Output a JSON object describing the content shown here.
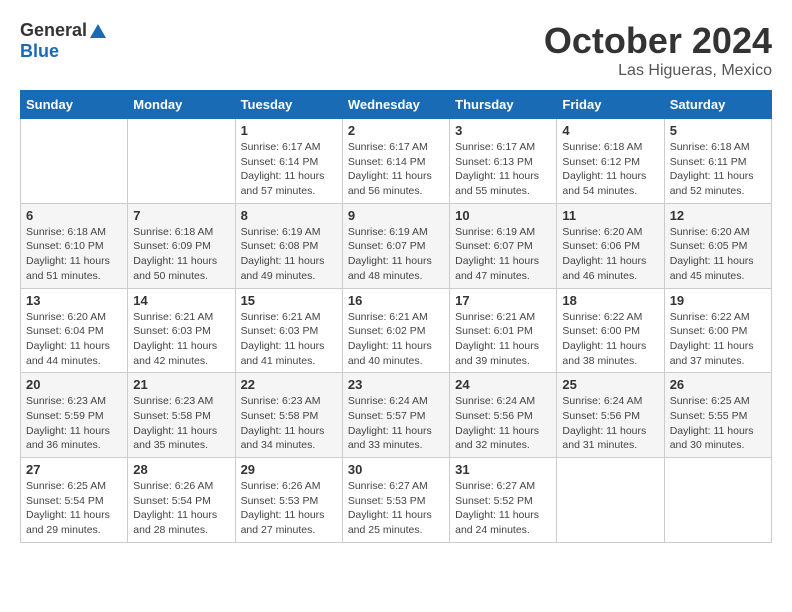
{
  "logo": {
    "general": "General",
    "blue": "Blue"
  },
  "title": {
    "month": "October 2024",
    "location": "Las Higueras, Mexico"
  },
  "calendar": {
    "headers": [
      "Sunday",
      "Monday",
      "Tuesday",
      "Wednesday",
      "Thursday",
      "Friday",
      "Saturday"
    ],
    "weeks": [
      [
        {
          "day": "",
          "info": ""
        },
        {
          "day": "",
          "info": ""
        },
        {
          "day": "1",
          "info": "Sunrise: 6:17 AM\nSunset: 6:14 PM\nDaylight: 11 hours and 57 minutes."
        },
        {
          "day": "2",
          "info": "Sunrise: 6:17 AM\nSunset: 6:14 PM\nDaylight: 11 hours and 56 minutes."
        },
        {
          "day": "3",
          "info": "Sunrise: 6:17 AM\nSunset: 6:13 PM\nDaylight: 11 hours and 55 minutes."
        },
        {
          "day": "4",
          "info": "Sunrise: 6:18 AM\nSunset: 6:12 PM\nDaylight: 11 hours and 54 minutes."
        },
        {
          "day": "5",
          "info": "Sunrise: 6:18 AM\nSunset: 6:11 PM\nDaylight: 11 hours and 52 minutes."
        }
      ],
      [
        {
          "day": "6",
          "info": "Sunrise: 6:18 AM\nSunset: 6:10 PM\nDaylight: 11 hours and 51 minutes."
        },
        {
          "day": "7",
          "info": "Sunrise: 6:18 AM\nSunset: 6:09 PM\nDaylight: 11 hours and 50 minutes."
        },
        {
          "day": "8",
          "info": "Sunrise: 6:19 AM\nSunset: 6:08 PM\nDaylight: 11 hours and 49 minutes."
        },
        {
          "day": "9",
          "info": "Sunrise: 6:19 AM\nSunset: 6:07 PM\nDaylight: 11 hours and 48 minutes."
        },
        {
          "day": "10",
          "info": "Sunrise: 6:19 AM\nSunset: 6:07 PM\nDaylight: 11 hours and 47 minutes."
        },
        {
          "day": "11",
          "info": "Sunrise: 6:20 AM\nSunset: 6:06 PM\nDaylight: 11 hours and 46 minutes."
        },
        {
          "day": "12",
          "info": "Sunrise: 6:20 AM\nSunset: 6:05 PM\nDaylight: 11 hours and 45 minutes."
        }
      ],
      [
        {
          "day": "13",
          "info": "Sunrise: 6:20 AM\nSunset: 6:04 PM\nDaylight: 11 hours and 44 minutes."
        },
        {
          "day": "14",
          "info": "Sunrise: 6:21 AM\nSunset: 6:03 PM\nDaylight: 11 hours and 42 minutes."
        },
        {
          "day": "15",
          "info": "Sunrise: 6:21 AM\nSunset: 6:03 PM\nDaylight: 11 hours and 41 minutes."
        },
        {
          "day": "16",
          "info": "Sunrise: 6:21 AM\nSunset: 6:02 PM\nDaylight: 11 hours and 40 minutes."
        },
        {
          "day": "17",
          "info": "Sunrise: 6:21 AM\nSunset: 6:01 PM\nDaylight: 11 hours and 39 minutes."
        },
        {
          "day": "18",
          "info": "Sunrise: 6:22 AM\nSunset: 6:00 PM\nDaylight: 11 hours and 38 minutes."
        },
        {
          "day": "19",
          "info": "Sunrise: 6:22 AM\nSunset: 6:00 PM\nDaylight: 11 hours and 37 minutes."
        }
      ],
      [
        {
          "day": "20",
          "info": "Sunrise: 6:23 AM\nSunset: 5:59 PM\nDaylight: 11 hours and 36 minutes."
        },
        {
          "day": "21",
          "info": "Sunrise: 6:23 AM\nSunset: 5:58 PM\nDaylight: 11 hours and 35 minutes."
        },
        {
          "day": "22",
          "info": "Sunrise: 6:23 AM\nSunset: 5:58 PM\nDaylight: 11 hours and 34 minutes."
        },
        {
          "day": "23",
          "info": "Sunrise: 6:24 AM\nSunset: 5:57 PM\nDaylight: 11 hours and 33 minutes."
        },
        {
          "day": "24",
          "info": "Sunrise: 6:24 AM\nSunset: 5:56 PM\nDaylight: 11 hours and 32 minutes."
        },
        {
          "day": "25",
          "info": "Sunrise: 6:24 AM\nSunset: 5:56 PM\nDaylight: 11 hours and 31 minutes."
        },
        {
          "day": "26",
          "info": "Sunrise: 6:25 AM\nSunset: 5:55 PM\nDaylight: 11 hours and 30 minutes."
        }
      ],
      [
        {
          "day": "27",
          "info": "Sunrise: 6:25 AM\nSunset: 5:54 PM\nDaylight: 11 hours and 29 minutes."
        },
        {
          "day": "28",
          "info": "Sunrise: 6:26 AM\nSunset: 5:54 PM\nDaylight: 11 hours and 28 minutes."
        },
        {
          "day": "29",
          "info": "Sunrise: 6:26 AM\nSunset: 5:53 PM\nDaylight: 11 hours and 27 minutes."
        },
        {
          "day": "30",
          "info": "Sunrise: 6:27 AM\nSunset: 5:53 PM\nDaylight: 11 hours and 25 minutes."
        },
        {
          "day": "31",
          "info": "Sunrise: 6:27 AM\nSunset: 5:52 PM\nDaylight: 11 hours and 24 minutes."
        },
        {
          "day": "",
          "info": ""
        },
        {
          "day": "",
          "info": ""
        }
      ]
    ]
  }
}
